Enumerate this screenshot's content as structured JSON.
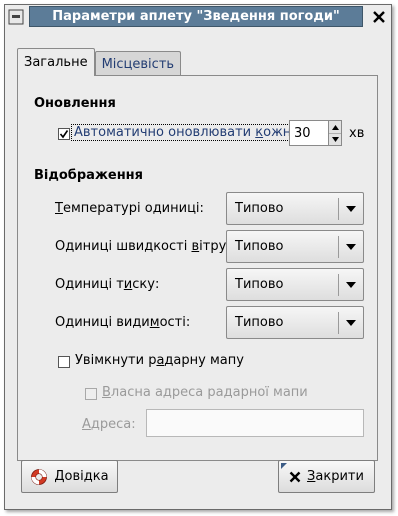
{
  "window": {
    "title": "Параметри аплету \"Зведення погоди\""
  },
  "tabs": [
    {
      "label": "Загальне",
      "active": true
    },
    {
      "label": "Місцевість",
      "active": false
    }
  ],
  "update_section": {
    "title": "Оновлення",
    "auto_update": {
      "label_pre": "Автоматично оновлювати ",
      "label_accel": "к",
      "label_post": "ожні",
      "checked": true
    },
    "interval": {
      "value": "30",
      "unit": "хв"
    }
  },
  "display_section": {
    "title": "Відображення",
    "rows": [
      {
        "label_pre": "",
        "label_accel": "Т",
        "label_post": "емпературі одиниці:",
        "value": "Типово"
      },
      {
        "label_pre": "Одиниці швидкості ",
        "label_accel": "в",
        "label_post": "ітру:",
        "value": "Типово"
      },
      {
        "label_pre": "Одиниці т",
        "label_accel": "и",
        "label_post": "ску:",
        "value": "Типово"
      },
      {
        "label_pre": "Одиниці види",
        "label_accel": "м",
        "label_post": "ості:",
        "value": "Типово"
      }
    ],
    "radar_enable": {
      "label_pre": "Увімкнути р",
      "label_accel": "а",
      "label_post": "дарну мапу",
      "checked": false
    },
    "radar_custom": {
      "label_pre": "",
      "label_accel": "В",
      "label_post": "ласна адреса радарної мапи",
      "checked": false,
      "enabled": false
    },
    "address": {
      "label_pre": "",
      "label_accel": "А",
      "label_post": "дреса:",
      "value": "",
      "enabled": false
    }
  },
  "buttons": {
    "help": {
      "label_accel": "Д",
      "label_post": "овідка",
      "icon": "lifebuoy-icon"
    },
    "close": {
      "label_accel": "З",
      "label_post": "акрити",
      "icon": "close-x-icon"
    }
  },
  "colors": {
    "titlebar": "#5c7c98",
    "window_bg": "#ececec",
    "inactive_tab_text": "#233d73",
    "focus_label_text": "#233d73",
    "help_icon_red": "#d23a24"
  }
}
